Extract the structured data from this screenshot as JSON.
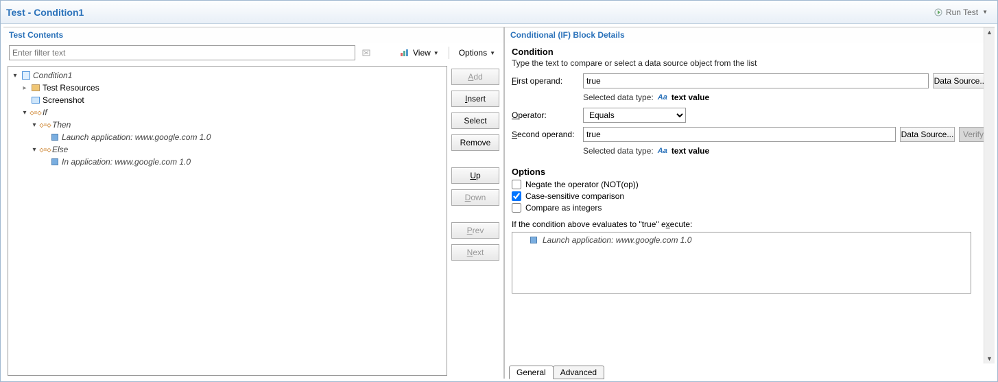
{
  "header": {
    "title": "Test - Condition1",
    "run_label": "Run Test"
  },
  "left": {
    "title": "Test Contents",
    "filter_placeholder": "Enter filter text",
    "view_label": "View",
    "options_label": "Options",
    "tree": {
      "root": "Condition1",
      "resources": "Test Resources",
      "screenshot": "Screenshot",
      "if": "If",
      "then": "Then",
      "then_child": "Launch application: www.google.com  1.0",
      "else": "Else",
      "else_child": "In application: www.google.com  1.0"
    },
    "buttons": {
      "add": "Add",
      "insert": "Insert",
      "select": "Select",
      "remove": "Remove",
      "up": "Up",
      "down": "Down",
      "prev": "Prev",
      "next": "Next"
    }
  },
  "right": {
    "title": "Conditional (IF) Block Details",
    "section_title": "Condition",
    "section_sub": "Type the text to compare or select a data source object from the list",
    "first_label": "First operand:",
    "first_value": "true",
    "ds_label": "Data Source...",
    "verify_label": "Verify",
    "dt_label": "Selected data type:",
    "dt_value": "text value",
    "operator_label": "Operator:",
    "operator_value": "Equals",
    "second_label": "Second operand:",
    "second_value": "true",
    "options_title": "Options",
    "chk_negate": "Negate the operator (NOT(op))",
    "chk_case": "Case-sensitive comparison",
    "chk_int": "Compare as integers",
    "exec_label_pre": "If the condition above evaluates to \"true\" e",
    "exec_label_u": "x",
    "exec_label_post": "ecute:",
    "exec_item": "Launch application: www.google.com  1.0",
    "tabs": {
      "general": "General",
      "advanced": "Advanced"
    }
  }
}
